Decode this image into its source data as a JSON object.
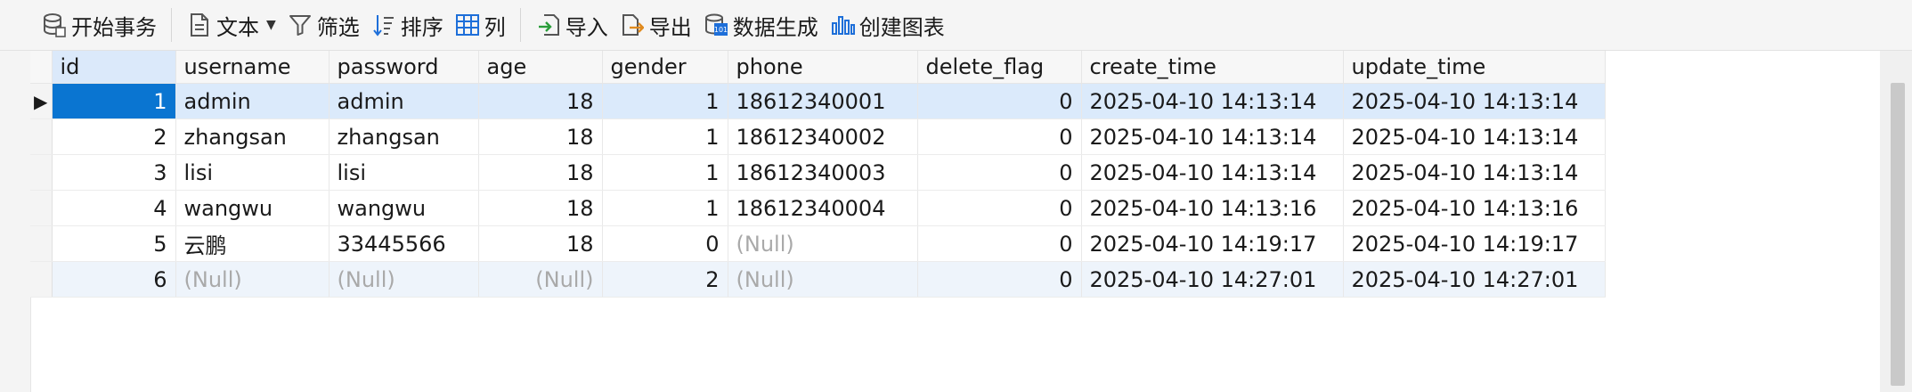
{
  "toolbar": {
    "begin_transaction": "开始事务",
    "text": "文本",
    "filter": "筛选",
    "sort": "排序",
    "columns": "列",
    "import": "导入",
    "export": "导出",
    "data_generate": "数据生成",
    "create_chart": "创建图表"
  },
  "table": {
    "columns": [
      "id",
      "username",
      "password",
      "age",
      "gender",
      "phone",
      "delete_flag",
      "create_time",
      "update_time"
    ],
    "rows": [
      {
        "id": "1",
        "username": "admin",
        "password": "admin",
        "age": "18",
        "gender": "1",
        "phone": "18612340001",
        "delete_flag": "0",
        "create_time": "2025-04-10 14:13:14",
        "update_time": "2025-04-10 14:13:14"
      },
      {
        "id": "2",
        "username": "zhangsan",
        "password": "zhangsan",
        "age": "18",
        "gender": "1",
        "phone": "18612340002",
        "delete_flag": "0",
        "create_time": "2025-04-10 14:13:14",
        "update_time": "2025-04-10 14:13:14"
      },
      {
        "id": "3",
        "username": "lisi",
        "password": "lisi",
        "age": "18",
        "gender": "1",
        "phone": "18612340003",
        "delete_flag": "0",
        "create_time": "2025-04-10 14:13:14",
        "update_time": "2025-04-10 14:13:14"
      },
      {
        "id": "4",
        "username": "wangwu",
        "password": "wangwu",
        "age": "18",
        "gender": "1",
        "phone": "18612340004",
        "delete_flag": "0",
        "create_time": "2025-04-10 14:13:16",
        "update_time": "2025-04-10 14:13:16"
      },
      {
        "id": "5",
        "username": "云鹏",
        "password": "33445566",
        "age": "18",
        "gender": "0",
        "phone": "(Null)",
        "delete_flag": "0",
        "create_time": "2025-04-10 14:19:17",
        "update_time": "2025-04-10 14:19:17"
      },
      {
        "id": "6",
        "username": "(Null)",
        "password": "(Null)",
        "age": "(Null)",
        "gender": "2",
        "phone": "(Null)",
        "delete_flag": "0",
        "create_time": "2025-04-10 14:27:01",
        "update_time": "2025-04-10 14:27:01"
      }
    ]
  },
  "colors": {
    "selection": "#0a75d1",
    "row_highlight": "#dbeafb",
    "null_text": "#a9a9a9"
  }
}
